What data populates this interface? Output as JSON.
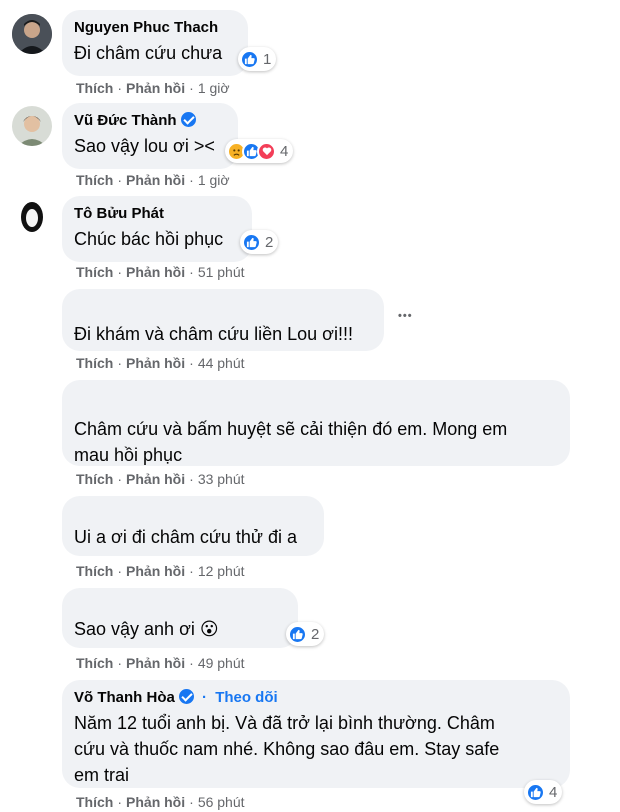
{
  "actions": {
    "like": "Thích",
    "reply": "Phản hồi",
    "separator": "·"
  },
  "follow_label": "Theo dõi",
  "more_label": "•••",
  "colors": {
    "bubble": "#f0f2f5",
    "like_blue": "#1877f2",
    "meta_gray": "#65676b"
  },
  "comments": [
    {
      "author": "Nguyen Phuc Thach",
      "text": "Đi châm cứu chưa",
      "reaction_count": "1",
      "time": "1 giờ"
    },
    {
      "author": "Vũ Đức Thành",
      "text": "Sao vậy lou ơi ><",
      "reaction_count": "4",
      "time": "1 giờ"
    },
    {
      "author": "Tô Bửu Phát",
      "text": "Chúc bác hồi phục",
      "reaction_count": "2",
      "time": "51 phút"
    },
    {
      "author": "",
      "text": "Đi khám và châm cứu liền Lou ơi!!!",
      "time": "44 phút"
    },
    {
      "author": "",
      "text_line1": "Châm cứu và bấm huyệt sẽ cải thiện đó em. Mong em",
      "text_line2": "mau hồi phục",
      "time": "33 phút"
    },
    {
      "author": "",
      "text": "Ui a ơi đi châm cứu thử đi a",
      "time": "12 phút"
    },
    {
      "author": "",
      "text": "Sao vậy anh ơi 😮",
      "reaction_count": "2",
      "time": "49 phút"
    },
    {
      "author": "Võ Thanh Hòa",
      "text_line1": "Năm 12 tuổi anh bị. Và đã trở lại bình thường. Châm",
      "text_line2": "cứu và thuốc nam nhé. Không sao đâu em. Stay safe",
      "text_line3": "em trai",
      "reaction_count": "4",
      "time": "56 phút"
    }
  ]
}
